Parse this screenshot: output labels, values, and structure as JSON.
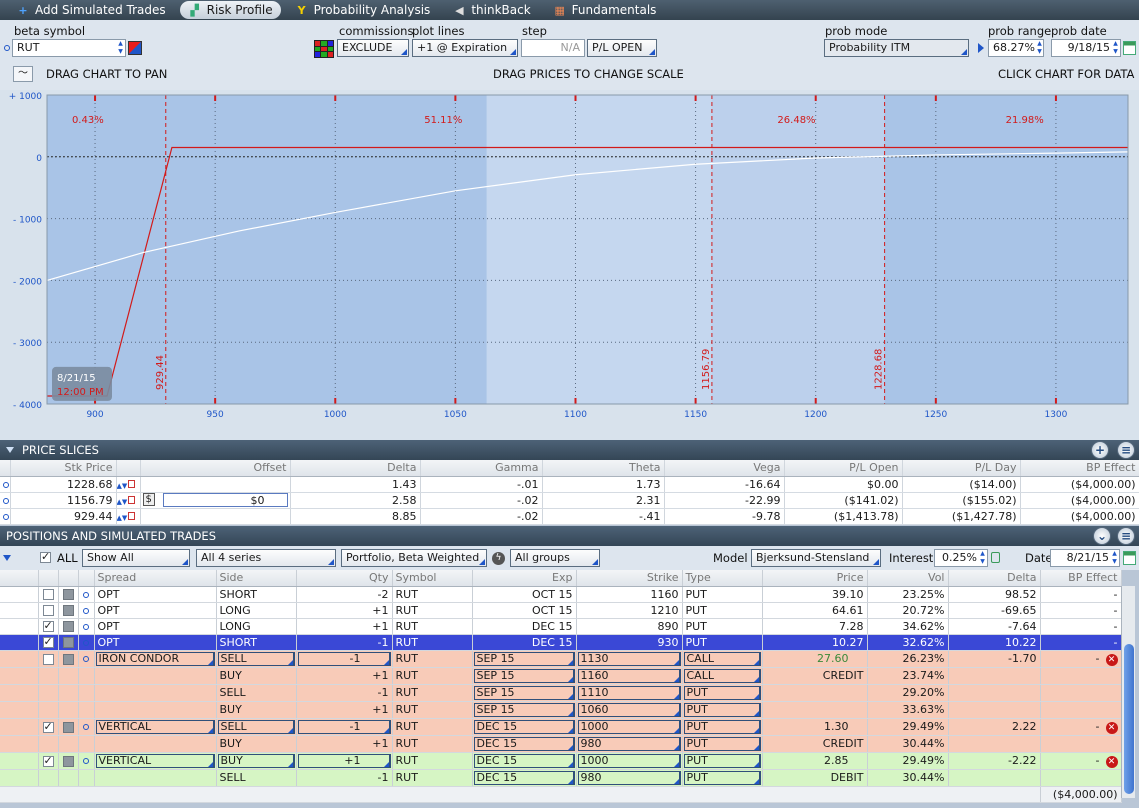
{
  "tabs": [
    {
      "label": "Add Simulated Trades",
      "icon": "plus-icon"
    },
    {
      "label": "Risk Profile",
      "icon": "risk-profile-icon",
      "active": true
    },
    {
      "label": "Probability Analysis",
      "icon": "probability-icon"
    },
    {
      "label": "thinkBack",
      "icon": "thinkback-icon"
    },
    {
      "label": "Fundamentals",
      "icon": "fundamentals-icon"
    }
  ],
  "controls": {
    "beta_symbol_label": "beta symbol",
    "beta_symbol": "RUT",
    "commissions_label": "commissions",
    "commissions": "EXCLUDE",
    "plot_lines_label": "plot lines",
    "plot_lines": "+1 @ Expiration",
    "step_label": "step",
    "step": "N/A",
    "pl_mode": "P/L OPEN",
    "prob_mode_label": "prob mode",
    "prob_mode": "Probability ITM",
    "prob_range_label": "prob range",
    "prob_range": "68.27%",
    "prob_date_label": "prob date",
    "prob_date": "9/18/15",
    "drag_pan": "DRAG CHART TO PAN",
    "drag_prices": "DRAG PRICES TO CHANGE SCALE",
    "click_data": "CLICK CHART FOR DATA"
  },
  "chart_data": {
    "type": "line",
    "xlim": [
      880,
      1330
    ],
    "ylim": [
      -4000,
      1000
    ],
    "x_ticks": [
      900,
      950,
      1000,
      1050,
      1100,
      1150,
      1200,
      1250,
      1300
    ],
    "y_ticks": [
      {
        "v": 1000,
        "label": "+ 1000"
      },
      {
        "v": 0,
        "label": "0"
      },
      {
        "v": -1000,
        "label": "- 1000"
      },
      {
        "v": -2000,
        "label": "- 2000"
      },
      {
        "v": -3000,
        "label": "- 3000"
      },
      {
        "v": -4000,
        "label": "- 4000"
      }
    ],
    "vertical_lines": [
      {
        "x": 929.44,
        "label": "929.44"
      },
      {
        "x": 1156.79,
        "label": "1156.79"
      },
      {
        "x": 1228.68,
        "label": "1228.68"
      }
    ],
    "prob_labels": [
      {
        "x": 897,
        "label": "0.43%"
      },
      {
        "x": 1045,
        "label": "51.11%"
      },
      {
        "x": 1192,
        "label": "26.48%"
      },
      {
        "x": 1287,
        "label": "21.98%"
      }
    ],
    "range_band": [
      1063,
      1156.79
    ],
    "series": [
      {
        "color": "#d21a1a",
        "x": [
          880,
          905,
          932,
          1330
        ],
        "y": [
          -3870,
          -3870,
          150,
          150
        ]
      },
      {
        "color": "#ffffff",
        "x": [
          880,
          920,
          960,
          1000,
          1050,
          1100,
          1150,
          1200,
          1250,
          1300,
          1330
        ],
        "y": [
          -2000,
          -1550,
          -1200,
          -900,
          -550,
          -290,
          -120,
          -20,
          30,
          60,
          80
        ]
      }
    ],
    "date_badge": "8/21/15",
    "date_badge_sub": "12:00 PM"
  },
  "price_slices": {
    "title": "PRICE SLICES",
    "columns": [
      "Stk Price",
      "Offset",
      "Delta",
      "Gamma",
      "Theta",
      "Vega",
      "P/L Open",
      "P/L Day",
      "BP Effect"
    ],
    "rows": [
      {
        "price": "1228.68",
        "offset": "",
        "delta": "1.43",
        "gamma": "-.01",
        "theta": "1.73",
        "vega": "-16.64",
        "pl_open": "$0.00",
        "pl_day": "($14.00)",
        "bp": "($4,000.00)"
      },
      {
        "price": "1156.79",
        "offset": "$0",
        "delta": "2.58",
        "gamma": "-.02",
        "theta": "2.31",
        "vega": "-22.99",
        "pl_open": "($141.02)",
        "pl_day": "($155.02)",
        "bp": "($4,000.00)"
      },
      {
        "price": "929.44",
        "offset": "",
        "delta": "8.85",
        "gamma": "-.02",
        "theta": "-.41",
        "vega": "-9.78",
        "pl_open": "($1,413.78)",
        "pl_day": "($1,427.78)",
        "bp": "($4,000.00)"
      }
    ]
  },
  "positions": {
    "title": "POSITIONS AND SIMULATED TRADES",
    "all_label": "ALL",
    "show": "Show All",
    "series": "All 4 series",
    "weight": "Portfolio, Beta Weighted",
    "groups": "All groups",
    "model_label": "Model",
    "model": "Bjerksund-Stensland",
    "interest_label": "Interest",
    "interest": "0.25%",
    "date_label": "Date",
    "date": "8/21/15",
    "columns": [
      "Spread",
      "Side",
      "Qty",
      "Symbol",
      "Exp",
      "Strike",
      "Type",
      "Price",
      "Vol",
      "Delta",
      "BP Effect"
    ],
    "rows": [
      {
        "chk": false,
        "dot": true,
        "spread": "OPT",
        "side": "SHORT",
        "qty": "-2",
        "sym": "RUT",
        "exp": "OCT 15",
        "strike": "1160",
        "type": "PUT",
        "price": "39.10",
        "vol": "23.25%",
        "delta": "98.52",
        "bp": "-",
        "cls": ""
      },
      {
        "chk": false,
        "dot": true,
        "spread": "OPT",
        "side": "LONG",
        "qty": "+1",
        "sym": "RUT",
        "exp": "OCT 15",
        "strike": "1210",
        "type": "PUT",
        "price": "64.61",
        "vol": "20.72%",
        "delta": "-69.65",
        "bp": "-",
        "cls": ""
      },
      {
        "chk": true,
        "dot": true,
        "spread": "OPT",
        "side": "LONG",
        "qty": "+1",
        "sym": "RUT",
        "exp": "DEC 15",
        "strike": "890",
        "type": "PUT",
        "price": "7.28",
        "vol": "34.62%",
        "delta": "-7.64",
        "bp": "-",
        "cls": ""
      },
      {
        "chk": true,
        "dot": true,
        "spread": "OPT",
        "side": "SHORT",
        "qty": "-1",
        "sym": "RUT",
        "exp": "DEC 15",
        "strike": "930",
        "type": "PUT",
        "price": "10.27",
        "vol": "32.62%",
        "delta": "10.22",
        "bp": "-",
        "cls": "sel"
      },
      {
        "chk": false,
        "dot": true,
        "spread": "IRON CONDOR",
        "side": "SELL",
        "qty": "-1",
        "sym": "RUT",
        "exp": "SEP 15",
        "strike": "1130",
        "type": "CALL",
        "price": "27.60",
        "vol": "26.23%",
        "delta": "-1.70",
        "bp": "-",
        "cls": "pink",
        "lead": true,
        "x": true
      },
      {
        "spread": "",
        "side": "BUY",
        "qty": "+1",
        "sym": "RUT",
        "exp": "SEP 15",
        "strike": "1160",
        "type": "CALL",
        "price": "CREDIT",
        "vol": "23.74%",
        "delta": "",
        "bp": "",
        "cls": "pink",
        "sub": true
      },
      {
        "spread": "",
        "side": "SELL",
        "qty": "-1",
        "sym": "RUT",
        "exp": "SEP 15",
        "strike": "1110",
        "type": "PUT",
        "price": "",
        "vol": "29.20%",
        "delta": "",
        "bp": "",
        "cls": "pink",
        "sub": true
      },
      {
        "spread": "",
        "side": "BUY",
        "qty": "+1",
        "sym": "RUT",
        "exp": "SEP 15",
        "strike": "1060",
        "type": "PUT",
        "price": "",
        "vol": "33.63%",
        "delta": "",
        "bp": "",
        "cls": "pink",
        "sub": true
      },
      {
        "chk": true,
        "dot": true,
        "spread": "VERTICAL",
        "side": "SELL",
        "qty": "-1",
        "sym": "RUT",
        "exp": "DEC 15",
        "strike": "1000",
        "type": "PUT",
        "price": "1.30",
        "vol": "29.49%",
        "delta": "2.22",
        "bp": "-",
        "cls": "pink",
        "lead": true,
        "x": true
      },
      {
        "spread": "",
        "side": "BUY",
        "qty": "+1",
        "sym": "RUT",
        "exp": "DEC 15",
        "strike": "980",
        "type": "PUT",
        "price": "CREDIT",
        "vol": "30.44%",
        "delta": "",
        "bp": "",
        "cls": "pink",
        "sub": true
      },
      {
        "chk": true,
        "dot": true,
        "spread": "VERTICAL",
        "side": "BUY",
        "qty": "+1",
        "sym": "RUT",
        "exp": "DEC 15",
        "strike": "1000",
        "type": "PUT",
        "price": "2.85",
        "vol": "29.49%",
        "delta": "-2.22",
        "bp": "-",
        "cls": "green",
        "lead": true,
        "x": true
      },
      {
        "spread": "",
        "side": "SELL",
        "qty": "-1",
        "sym": "RUT",
        "exp": "DEC 15",
        "strike": "980",
        "type": "PUT",
        "price": "DEBIT",
        "vol": "30.44%",
        "delta": "",
        "bp": "",
        "cls": "green",
        "sub": true
      }
    ],
    "total_bp": "($4,000.00)"
  }
}
